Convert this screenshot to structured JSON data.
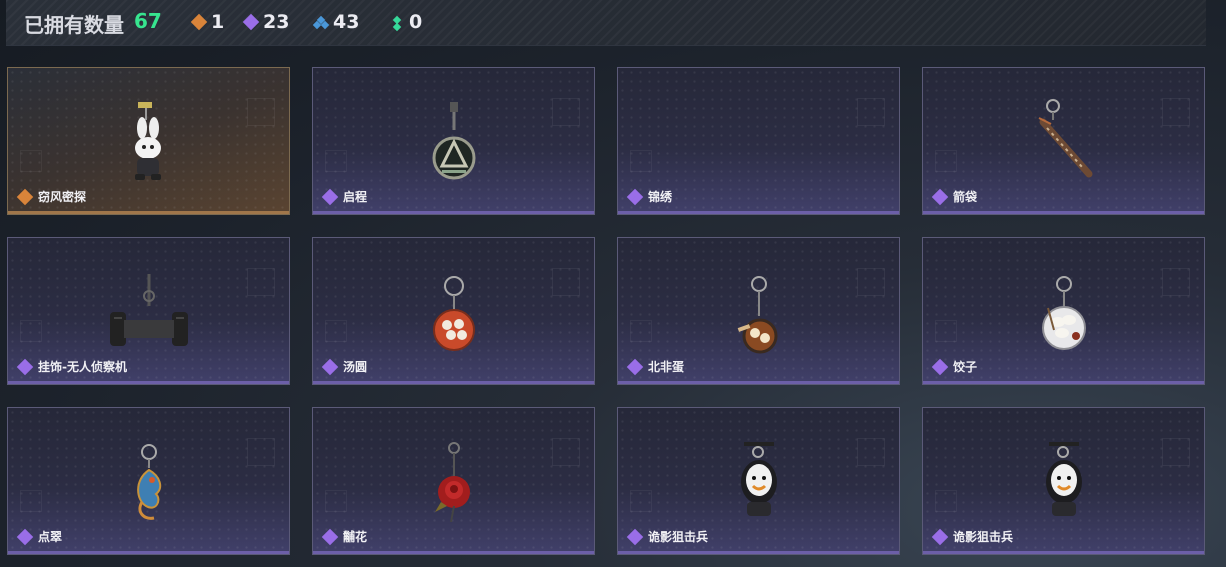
{
  "header": {
    "owned_label": "已拥有数量",
    "owned_count": "67",
    "stats": [
      {
        "icon": "orange-rarity-icon",
        "color": "#d9843a",
        "value": "1"
      },
      {
        "icon": "purple-rarity-icon",
        "color": "#9a6ee8",
        "value": "23"
      },
      {
        "icon": "blue-rarity-icon",
        "color": "#4a97d8",
        "value": "43"
      },
      {
        "icon": "green-rarity-icon",
        "color": "#36d99a",
        "value": "0"
      }
    ]
  },
  "items": [
    {
      "name": "窃风密探",
      "rarity": "orange",
      "icon": "rabbit-charm-icon"
    },
    {
      "name": "启程",
      "rarity": "purple",
      "icon": "badge-medallion-charm-icon"
    },
    {
      "name": "锦绣",
      "rarity": "purple",
      "icon": ""
    },
    {
      "name": "箭袋",
      "rarity": "purple",
      "icon": "quiver-charm-icon"
    },
    {
      "name": "挂饰-无人侦察机",
      "rarity": "purple",
      "icon": "drone-charm-icon"
    },
    {
      "name": "汤圆",
      "rarity": "purple",
      "icon": "tangyuan-bowl-charm-icon"
    },
    {
      "name": "北非蛋",
      "rarity": "purple",
      "icon": "shakshuka-pan-charm-icon"
    },
    {
      "name": "饺子",
      "rarity": "purple",
      "icon": "dumpling-plate-charm-icon"
    },
    {
      "name": "点翠",
      "rarity": "purple",
      "icon": "phoenix-charm-icon"
    },
    {
      "name": "黼花",
      "rarity": "purple",
      "icon": "rose-charm-icon"
    },
    {
      "name": "诡影狙击兵",
      "rarity": "purple",
      "icon": "sniper-doll-charm-icon"
    },
    {
      "name": "诡影狙击兵",
      "rarity": "purple",
      "icon": "sniper-doll-charm-icon"
    }
  ],
  "rarity_colors": {
    "orange": "#d9843a",
    "purple": "#9a6ee8"
  }
}
